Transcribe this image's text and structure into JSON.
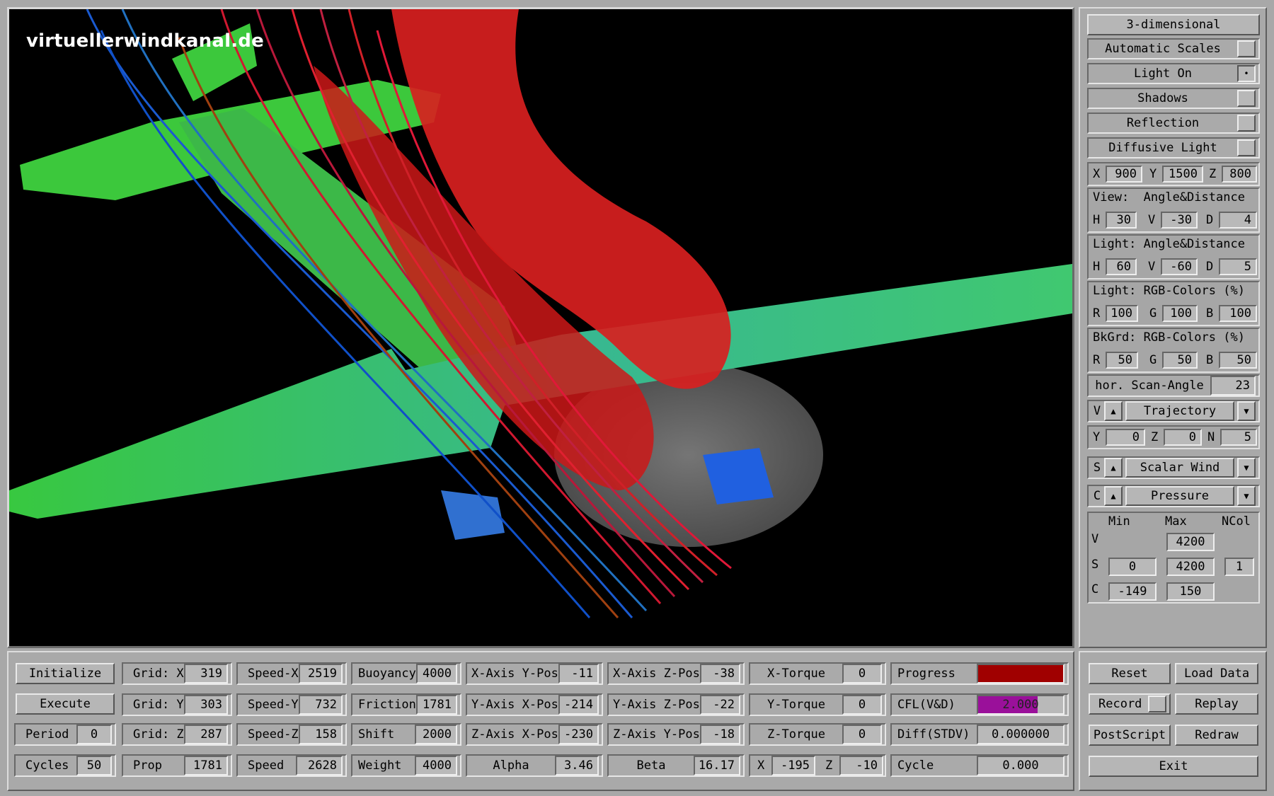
{
  "watermark": "virtuellerwindkanal.de",
  "colors": {
    "progress_bar": "#a00000",
    "cfl_bar": "#9a109a",
    "wing_green": "#3cc83c",
    "flow_red": "#e02020",
    "streamline_blue": "#1060d0"
  },
  "side": {
    "mode_button": "3-dimensional",
    "toggles": [
      {
        "label": "Automatic Scales",
        "on": false
      },
      {
        "label": "Light On",
        "on": true
      },
      {
        "label": "Shadows",
        "on": false
      },
      {
        "label": "Reflection",
        "on": false
      },
      {
        "label": "Diffusive Light",
        "on": false
      }
    ],
    "pos": {
      "x_label": "X",
      "x": "900",
      "y_label": "Y",
      "y": "1500",
      "z_label": "Z",
      "z": "800"
    },
    "view": {
      "title": "View:  Angle&Distance",
      "h_label": "H",
      "h": "30",
      "v_label": "V",
      "v": "-30",
      "d_label": "D",
      "d": "4"
    },
    "light": {
      "title": "Light: Angle&Distance",
      "h_label": "H",
      "h": "60",
      "v_label": "V",
      "v": "-60",
      "d_label": "D",
      "d": "5"
    },
    "light_rgb": {
      "title": "Light: RGB-Colors (%)",
      "r_label": "R",
      "r": "100",
      "g_label": "G",
      "g": "100",
      "b_label": "B",
      "b": "100"
    },
    "bkgrd_rgb": {
      "title": "BkGrd: RGB-Colors (%)",
      "r_label": "R",
      "r": "50",
      "g_label": "G",
      "g": "50",
      "b_label": "B",
      "b": "50"
    },
    "scan": {
      "label": "hor. Scan-Angle",
      "value": "23"
    },
    "v_select": {
      "letter": "V",
      "value": "Trajectory"
    },
    "yzn": {
      "y_label": "Y",
      "y": "0",
      "z_label": "Z",
      "z": "0",
      "n_label": "N",
      "n": "5"
    },
    "s_select": {
      "letter": "S",
      "value": "Scalar Wind"
    },
    "c_select": {
      "letter": "C",
      "value": "Pressure"
    },
    "scales": {
      "min_label": "Min",
      "max_label": "Max",
      "ncol_label": "NCol",
      "v_label": "V",
      "v_max": "4200",
      "s_label": "S",
      "s_min": "0",
      "s_max": "4200",
      "s_ncol": "1",
      "c_label": "C",
      "c_min": "-149",
      "c_max": "150"
    }
  },
  "bottom": {
    "initialize": "Initialize",
    "execute": "Execute",
    "period_label": "Period",
    "period": "0",
    "cycles_label": "Cycles",
    "cycles": "50",
    "gridx_label": "Grid: X",
    "gridx": "319",
    "gridy_label": "Grid: Y",
    "gridy": "303",
    "gridz_label": "Grid: Z",
    "gridz": "287",
    "prop_label": "Prop",
    "prop": "1781",
    "speedx_label": "Speed-X",
    "speedx": "2519",
    "speedy_label": "Speed-Y",
    "speedy": "732",
    "speedz_label": "Speed-Z",
    "speedz": "158",
    "speed_label": "Speed",
    "speed": "2628",
    "buoyancy_label": "Buoyancy",
    "buoyancy": "4000",
    "friction_label": "Friction",
    "friction": "1781",
    "shift_label": "Shift",
    "shift": "2000",
    "weight_label": "Weight",
    "weight": "4000",
    "xaxis_ypos_label": "X-Axis Y-Pos",
    "xaxis_ypos": "-11",
    "yaxis_xpos_label": "Y-Axis X-Pos",
    "yaxis_xpos": "-214",
    "zaxis_xpos_label": "Z-Axis X-Pos",
    "zaxis_xpos": "-230",
    "alpha_label": "Alpha",
    "alpha": "3.46",
    "xaxis_zpos_label": "X-Axis Z-Pos",
    "xaxis_zpos": "-38",
    "yaxis_zpos_label": "Y-Axis Z-Pos",
    "yaxis_zpos": "-22",
    "zaxis_ypos_label": "Z-Axis Y-Pos",
    "zaxis_ypos": "-18",
    "beta_label": "Beta",
    "beta": "16.17",
    "xtorque_label": "X-Torque",
    "xtorque": "0",
    "ytorque_label": "Y-Torque",
    "ytorque": "0",
    "ztorque_label": "Z-Torque",
    "ztorque": "0",
    "x_label": "X",
    "x": "-195",
    "z_label": "Z",
    "z": "-10",
    "progress_label": "Progress",
    "progress_fraction": 1.0,
    "cfl_label": "CFL(V&D)",
    "cfl": "2.000",
    "diff_label": "Diff(STDV)",
    "diff": "0.000000",
    "cycle_label": "Cycle",
    "cycle": "0.000"
  },
  "actions": {
    "reset": "Reset",
    "load_data": "Load Data",
    "record": "Record",
    "replay": "Replay",
    "postscript": "PostScript",
    "redraw": "Redraw",
    "exit": "Exit"
  }
}
